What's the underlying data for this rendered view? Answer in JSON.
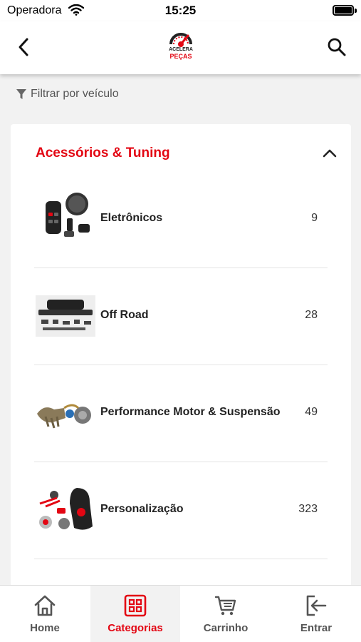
{
  "status_bar": {
    "carrier": "Operadora",
    "time": "15:25"
  },
  "header": {
    "logo_line1": "ACELERA",
    "logo_line2": "PEÇAS",
    "icons": {
      "back": "chevron-left-icon",
      "search": "search-icon"
    }
  },
  "filter": {
    "label": "Filtrar por veículo",
    "icon": "funnel-icon"
  },
  "section": {
    "title": "Acessórios & Tuning",
    "expanded": true,
    "categories": [
      {
        "name": "Eletrônicos",
        "count": "9"
      },
      {
        "name": "Off Road",
        "count": "28"
      },
      {
        "name": "Performance Motor & Suspensão",
        "count": "49"
      },
      {
        "name": "Personalização",
        "count": "323"
      }
    ]
  },
  "tabs": [
    {
      "label": "Home",
      "icon": "home-icon",
      "active": false
    },
    {
      "label": "Categorias",
      "icon": "grid-icon",
      "active": true
    },
    {
      "label": "Carrinho",
      "icon": "cart-icon",
      "active": false
    },
    {
      "label": "Entrar",
      "icon": "login-icon",
      "active": false
    }
  ],
  "colors": {
    "accent": "#e30613",
    "text": "#222222",
    "muted": "#555555",
    "background": "#f2f2f2"
  }
}
